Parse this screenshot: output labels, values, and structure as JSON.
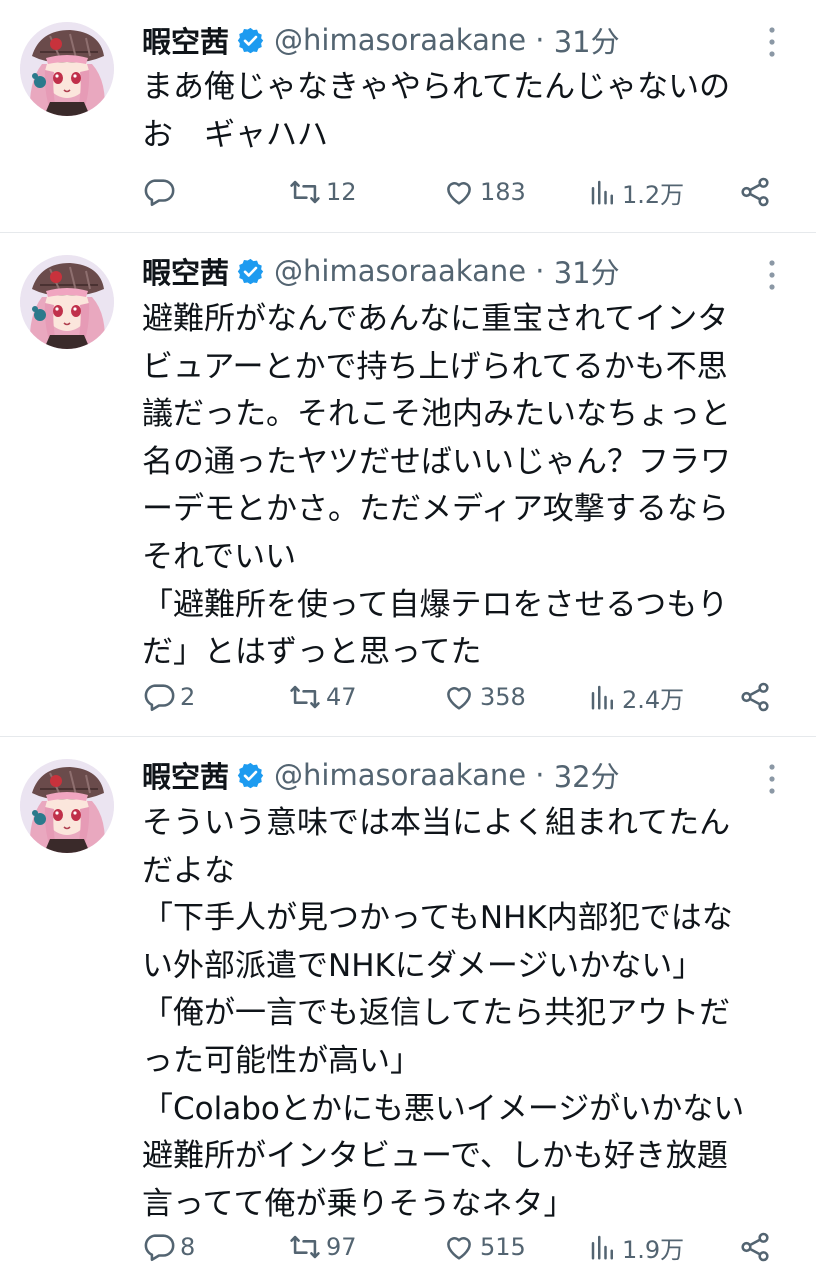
{
  "colors": {
    "text": "#0f1419",
    "muted": "#536471",
    "verified": "#1d9bf0",
    "divider": "#e6e9ec"
  },
  "tweets": [
    {
      "author": "暇空茜",
      "handle": "@himasoraakane",
      "time": "31分",
      "lines": [
        "まあ俺じゃなきゃやられてたんじゃないの",
        "お　ギャハハ"
      ],
      "stats": {
        "replies": "",
        "retweets": "12",
        "likes": "183",
        "views": "1.2万"
      }
    },
    {
      "author": "暇空茜",
      "handle": "@himasoraakane",
      "time": "31分",
      "lines": [
        "避難所がなんであんなに重宝されてインタ",
        "ビュアーとかで持ち上げられてるかも不思",
        "議だった。それこそ池内みたいなちょっと",
        "名の通ったヤツだせばいいじゃん？フラワ",
        "ーデモとかさ。ただメディア攻撃するなら",
        "それでいい",
        "「避難所を使って自爆テロをさせるつもり",
        "だ」とはずっと思ってた"
      ],
      "stats": {
        "replies": "2",
        "retweets": "47",
        "likes": "358",
        "views": "2.4万"
      }
    },
    {
      "author": "暇空茜",
      "handle": "@himasoraakane",
      "time": "32分",
      "lines": [
        "そういう意味では本当によく組まれてたん",
        "だよな",
        "「下手人が見つかってもNHK内部犯ではな",
        "い外部派遣でNHKにダメージいかない」",
        "「俺が一言でも返信してたら共犯アウトだ",
        "った可能性が高い」",
        "「Colaboとかにも悪いイメージがいかない",
        "避難所がインタビューで、しかも好き放題",
        "言ってて俺が乗りそうなネタ」"
      ],
      "stats": {
        "replies": "8",
        "retweets": "97",
        "likes": "515",
        "views": "1.9万"
      }
    }
  ]
}
